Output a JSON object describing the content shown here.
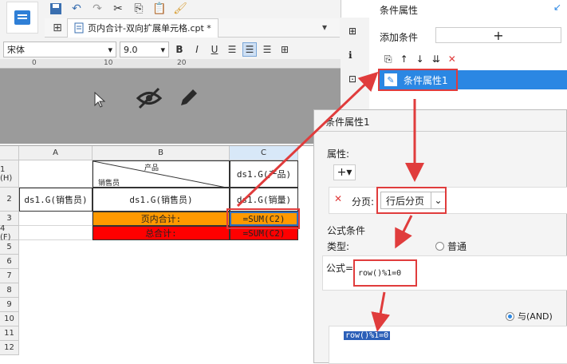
{
  "tab": {
    "title": "页内合计-双向扩展单元格.cpt *"
  },
  "format": {
    "font": "宋体",
    "size": "9.0"
  },
  "ruler": {
    "ticks": [
      "0",
      "10",
      "20"
    ]
  },
  "columns": [
    "A",
    "B",
    "C"
  ],
  "rows": [
    {
      "label": "1 (H)"
    },
    {
      "label": "2"
    },
    {
      "label": "3"
    },
    {
      "label": "4 (F)"
    },
    {
      "label": "5"
    },
    {
      "label": "6"
    },
    {
      "label": "7"
    },
    {
      "label": "8"
    },
    {
      "label": "9"
    },
    {
      "label": "10"
    },
    {
      "label": "11"
    },
    {
      "label": "12"
    }
  ],
  "cells": {
    "b1_top": "产品",
    "b1_bottom": "销售员",
    "c1": "ds1.G(产品)",
    "a2": "ds1.G(销售员)",
    "b2": "ds1.G(销售员)",
    "c2": "ds1.G(销量)",
    "b3": "页内合计:",
    "c3": "=SUM(C2)",
    "b4": "总合计:",
    "c4": "=SUM(C2)"
  },
  "panel": {
    "title": "条件属性",
    "add_condition": "添加条件",
    "add_btn": "+",
    "list_item": "条件属性1"
  },
  "dialog": {
    "title": "条件属性1",
    "attr_label": "属性:",
    "paging_label": "分页:",
    "paging_value": "行后分页",
    "formula_section": "公式条件",
    "type_label": "类型:",
    "type_option": "普通",
    "formula_label": "公式=",
    "formula_value": "row()%1=0",
    "and_label": "与(AND)",
    "formula_preview": "row()%1=0"
  },
  "colors": {
    "orange": "#ff9900",
    "red": "#ff0000",
    "selected_blue": "#2b87e3",
    "highlight_red": "#e03c3c"
  }
}
